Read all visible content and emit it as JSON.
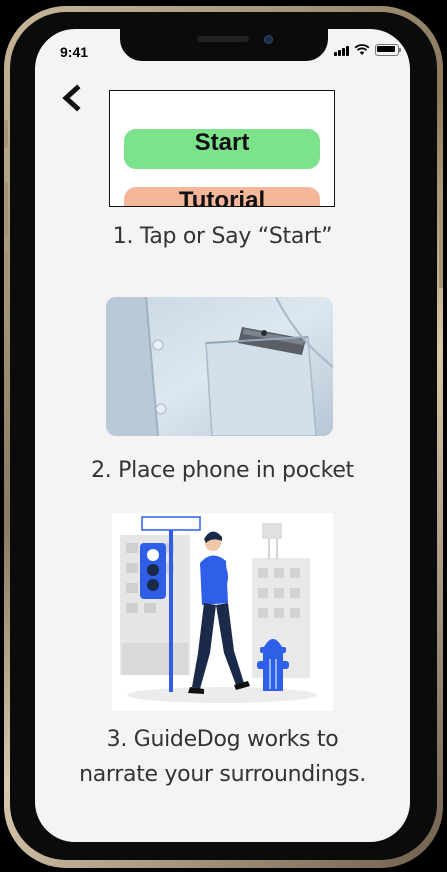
{
  "status_bar": {
    "time": "9:41"
  },
  "nav": {
    "back_icon": "chevron-left-icon"
  },
  "preview": {
    "start_label": "Start",
    "tutorial_label": "Tutorial"
  },
  "steps": [
    {
      "text": "1. Tap or Say “Start”"
    },
    {
      "text": "2. Place phone in pocket",
      "image": "shirt-pocket-phone-photo"
    },
    {
      "text_line1": "3. GuideDog works to",
      "text_line2": "narrate your surroundings.",
      "image": "man-walking-street-illustration"
    }
  ],
  "colors": {
    "start_green": "#7ce28b",
    "tutorial_orange": "#f4b79a",
    "illustration_blue": "#2f5ee8"
  }
}
